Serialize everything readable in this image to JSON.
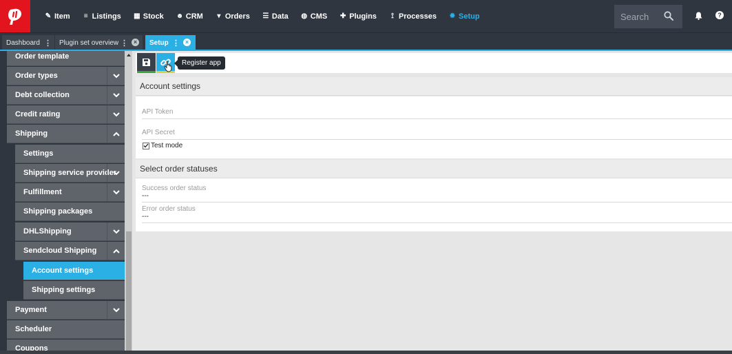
{
  "nav": {
    "items": [
      {
        "label": "Item",
        "icon": "tag-icon"
      },
      {
        "label": "Listings",
        "icon": "list-icon"
      },
      {
        "label": "Stock",
        "icon": "cubes-icon"
      },
      {
        "label": "CRM",
        "icon": "users-icon"
      },
      {
        "label": "Orders",
        "icon": "cart-icon"
      },
      {
        "label": "Data",
        "icon": "database-icon"
      },
      {
        "label": "CMS",
        "icon": "globe-icon"
      },
      {
        "label": "Plugins",
        "icon": "puzzle-icon"
      },
      {
        "label": "Processes",
        "icon": "process-icon"
      },
      {
        "label": "Setup",
        "icon": "gear-icon"
      }
    ],
    "active": "Setup",
    "search_placeholder": "Search"
  },
  "tabs": [
    {
      "label": "Dashboard"
    },
    {
      "label": "Plugin set overview"
    },
    {
      "label": "Setup"
    }
  ],
  "sidebar": {
    "items": [
      {
        "label": "Order template"
      },
      {
        "label": "Order types"
      },
      {
        "label": "Debt collection"
      },
      {
        "label": "Credit rating"
      },
      {
        "label": "Shipping"
      },
      {
        "label": "Settings"
      },
      {
        "label": "Shipping service provider"
      },
      {
        "label": "Fulfillment"
      },
      {
        "label": "Shipping packages"
      },
      {
        "label": "DHLShipping"
      },
      {
        "label": "Sendcloud Shipping"
      },
      {
        "label": "Account settings"
      },
      {
        "label": "Shipping settings"
      },
      {
        "label": "Payment"
      },
      {
        "label": "Scheduler"
      },
      {
        "label": "Coupons"
      }
    ]
  },
  "toolbar": {
    "tooltip": "Register app"
  },
  "account_settings": {
    "title": "Account settings",
    "api_token_label": "API Token",
    "api_secret_label": "API Secret",
    "test_mode_label": "Test mode",
    "test_mode_checked": true
  },
  "order_statuses": {
    "title": "Select order statuses",
    "success_label": "Success order status",
    "success_value": "---",
    "error_label": "Error order status",
    "error_value": "---"
  },
  "colors": {
    "accent": "#2ab0e4",
    "brand": "#e2141e",
    "nav_bg": "#2f3640"
  }
}
